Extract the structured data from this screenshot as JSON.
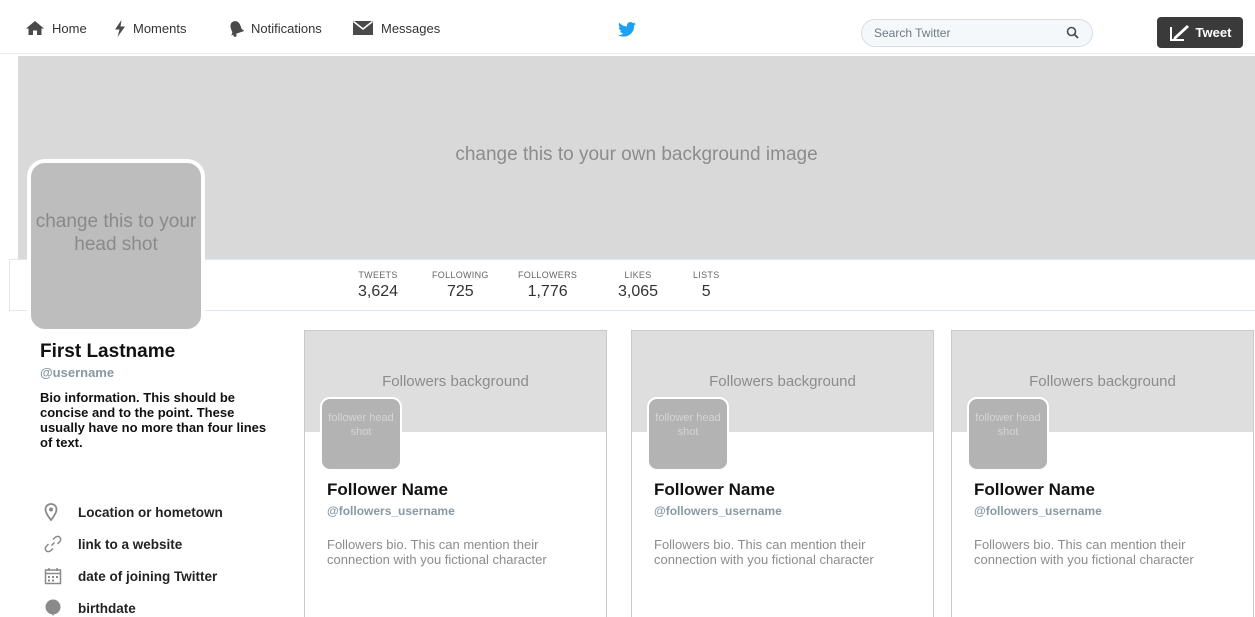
{
  "nav": {
    "home": "Home",
    "moments": "Moments",
    "notifications": "Notifications",
    "messages": "Messages",
    "search_placeholder": "Search Twitter",
    "tweet": "Tweet",
    "icons": [
      "home-icon",
      "moments-icon",
      "notifications-icon",
      "messages-icon",
      "twitter-bird-icon",
      "search-icon",
      "compose-icon"
    ]
  },
  "banner": {
    "text": "change this to your own background image"
  },
  "avatar": {
    "text": "change this to your head shot"
  },
  "stats": [
    {
      "label": "TWEETS",
      "value": "3,624"
    },
    {
      "label": "FOLLOWING",
      "value": "725"
    },
    {
      "label": "FOLLOWERS",
      "value": "1,776"
    },
    {
      "label": "LIKES",
      "value": "3,065"
    },
    {
      "label": "LISTS",
      "value": "5"
    }
  ],
  "profile": {
    "name": "First Lastname",
    "handle": "@username",
    "bio": "Bio information. This should be concise and to the point. These usually have no more than four lines of text.",
    "location": "Location or hometown",
    "link": "link to a website",
    "joined": "date of joining Twitter",
    "birthdate": "birthdate"
  },
  "followers": [
    {
      "background": "Followers background",
      "headshot": "follower head shot",
      "name": "Follower Name",
      "handle": "@followers_username",
      "bio": "Followers bio. This can mention their connection with you fictional character"
    },
    {
      "background": "Followers background",
      "headshot": "follower head shot",
      "name": "Follower Name",
      "handle": "@followers_username",
      "bio": "Followers bio. This can mention their connection with you fictional character"
    },
    {
      "background": "Followers background",
      "headshot": "follower head shot",
      "name": "Follower Name",
      "handle": "@followers_username",
      "bio": "Followers bio. This can mention their connection with you fictional character"
    }
  ],
  "colors": {
    "brand": "#1da1f2",
    "tweet_button": "#3a3a3a",
    "placeholder_gray": "#d9d9d9",
    "nav_icon": "#4a4a4a"
  }
}
